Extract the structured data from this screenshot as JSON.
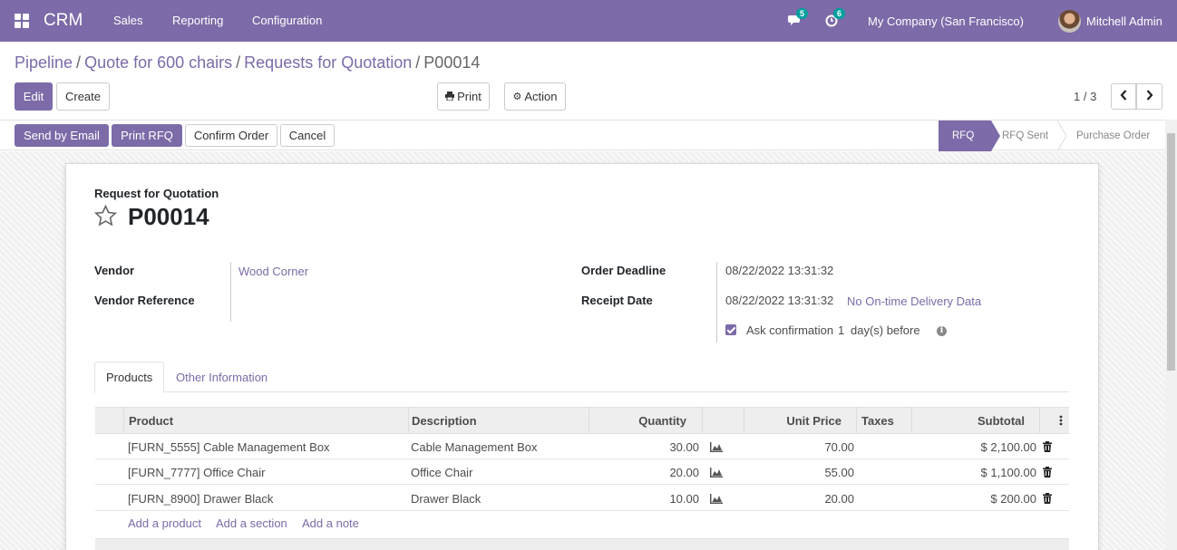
{
  "navbar": {
    "app_name": "CRM",
    "menu": [
      "Sales",
      "Reporting",
      "Configuration"
    ],
    "messages_badge": "5",
    "activities_badge": "6",
    "company": "My Company (San Francisco)",
    "user": "Mitchell Admin",
    "accent_color": "#7c6ba8"
  },
  "breadcrumb": {
    "items": [
      "Pipeline",
      "Quote for 600 chairs",
      "Requests for Quotation"
    ],
    "current": "P00014",
    "separator": "/"
  },
  "control_panel": {
    "edit_label": "Edit",
    "create_label": "Create",
    "print_label": "Print",
    "action_label": "Action",
    "pager": "1 / 3"
  },
  "statusbar": {
    "buttons": [
      "Send by Email",
      "Print RFQ",
      "Confirm Order",
      "Cancel"
    ],
    "stages": [
      "RFQ",
      "RFQ Sent",
      "Purchase Order"
    ],
    "active_stage": "RFQ"
  },
  "form": {
    "doc_type": "Request for Quotation",
    "name": "P00014",
    "vendor_label": "Vendor",
    "vendor_value": "Wood Corner",
    "vendor_ref_label": "Vendor Reference",
    "vendor_ref_value": "",
    "deadline_label": "Order Deadline",
    "deadline_value": "08/22/2022 13:31:32",
    "receipt_label": "Receipt Date",
    "receipt_value": "08/22/2022 13:31:32",
    "ontime_link": "No On-time Delivery Data",
    "ask_confirmation_text": "Ask confirmation",
    "ask_confirmation_days": "1",
    "ask_confirmation_suffix": "day(s) before",
    "ask_confirmation_checked": true
  },
  "tabs": [
    "Products",
    "Other Information"
  ],
  "table": {
    "headers": [
      "Product",
      "Description",
      "Quantity",
      "Unit Price",
      "Taxes",
      "Subtotal"
    ],
    "rows": [
      {
        "product": "[FURN_5555] Cable Management Box",
        "description": "Cable Management Box",
        "quantity": "30.00",
        "unit_price": "70.00",
        "taxes": "",
        "subtotal": "$ 2,100.00"
      },
      {
        "product": "[FURN_7777] Office Chair",
        "description": "Office Chair",
        "quantity": "20.00",
        "unit_price": "55.00",
        "taxes": "",
        "subtotal": "$ 1,100.00"
      },
      {
        "product": "[FURN_8900] Drawer Black",
        "description": "Drawer Black",
        "quantity": "10.00",
        "unit_price": "20.00",
        "taxes": "",
        "subtotal": "$ 200.00"
      }
    ],
    "add_links": [
      "Add a product",
      "Add a section",
      "Add a note"
    ]
  },
  "icons": {
    "apps": "apps-grid-icon",
    "messages": "chat-bubble-icon",
    "activities": "clock-icon",
    "print": "printer-icon",
    "action": "gear-icon",
    "star": "star-outline-icon",
    "forecast": "area-chart-icon",
    "delete": "trash-icon",
    "optional_cols": "vertical-dots-icon",
    "info": "info-icon"
  }
}
